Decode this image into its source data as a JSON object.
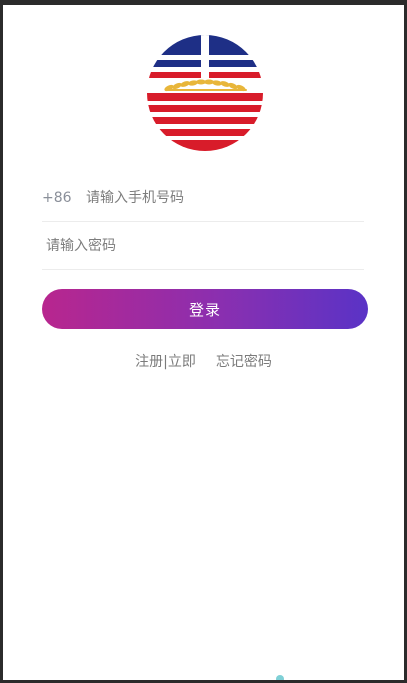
{
  "logo": {
    "icon": "striped-flag-wheat-logo",
    "colors": {
      "blue": "#1e2f86",
      "red": "#d81c2a",
      "gold": "#e8b63a",
      "white": "#ffffff"
    }
  },
  "form": {
    "country_code": "+86",
    "phone_placeholder": "请输入手机号码",
    "password_placeholder": "请输入密码",
    "login_label": "登录"
  },
  "links": {
    "register_label": "注册|立即",
    "forgot_label": "忘记密码"
  },
  "colors": {
    "button_gradient_start": "#b8268e",
    "button_gradient_end": "#5a33c6"
  }
}
